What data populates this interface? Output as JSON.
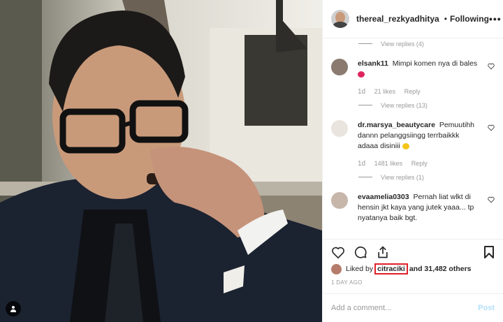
{
  "post": {
    "username": "thereal_rezkyadhitya",
    "verified_icon": "verified-badge-icon",
    "separator": "•",
    "follow_status": "Following",
    "more_label": "•••",
    "tag_icon": "person-tag-icon"
  },
  "comments": [
    {
      "view_replies": "View replies (4)"
    },
    {
      "username": "elsank11",
      "text": "Mimpi komen nya di bales",
      "emoji": "heart-eyes-emoji",
      "age": "1d",
      "likes": "21 likes",
      "reply": "Reply",
      "view_replies": "View replies (13)"
    },
    {
      "username": "dr.marsya_beautycare",
      "text": "Pemuutihh dannn pelanggsiingg terrbaikkk adaaa disiniii",
      "emoji": "smile-emoji",
      "age": "1d",
      "likes": "1481 likes",
      "reply": "Reply",
      "view_replies": "View replies (1)"
    },
    {
      "username": "evaamelia0303",
      "text": "Pernah liat wlkt di hensin jkt kaya yang jutek yaaa... tp nyatanya baik bgt."
    }
  ],
  "likes": {
    "prefix": "Liked by",
    "highlighted_user": "citraciki",
    "suffix": "and 31,482 others"
  },
  "time_ago": "1 DAY AGO",
  "add_comment": {
    "placeholder": "Add a comment...",
    "post_label": "Post"
  },
  "colors": {
    "accent_blue": "#3897f0",
    "post_disabled": "#b2dffc",
    "highlight_box": "#e0202a",
    "muted_text": "#999999"
  }
}
